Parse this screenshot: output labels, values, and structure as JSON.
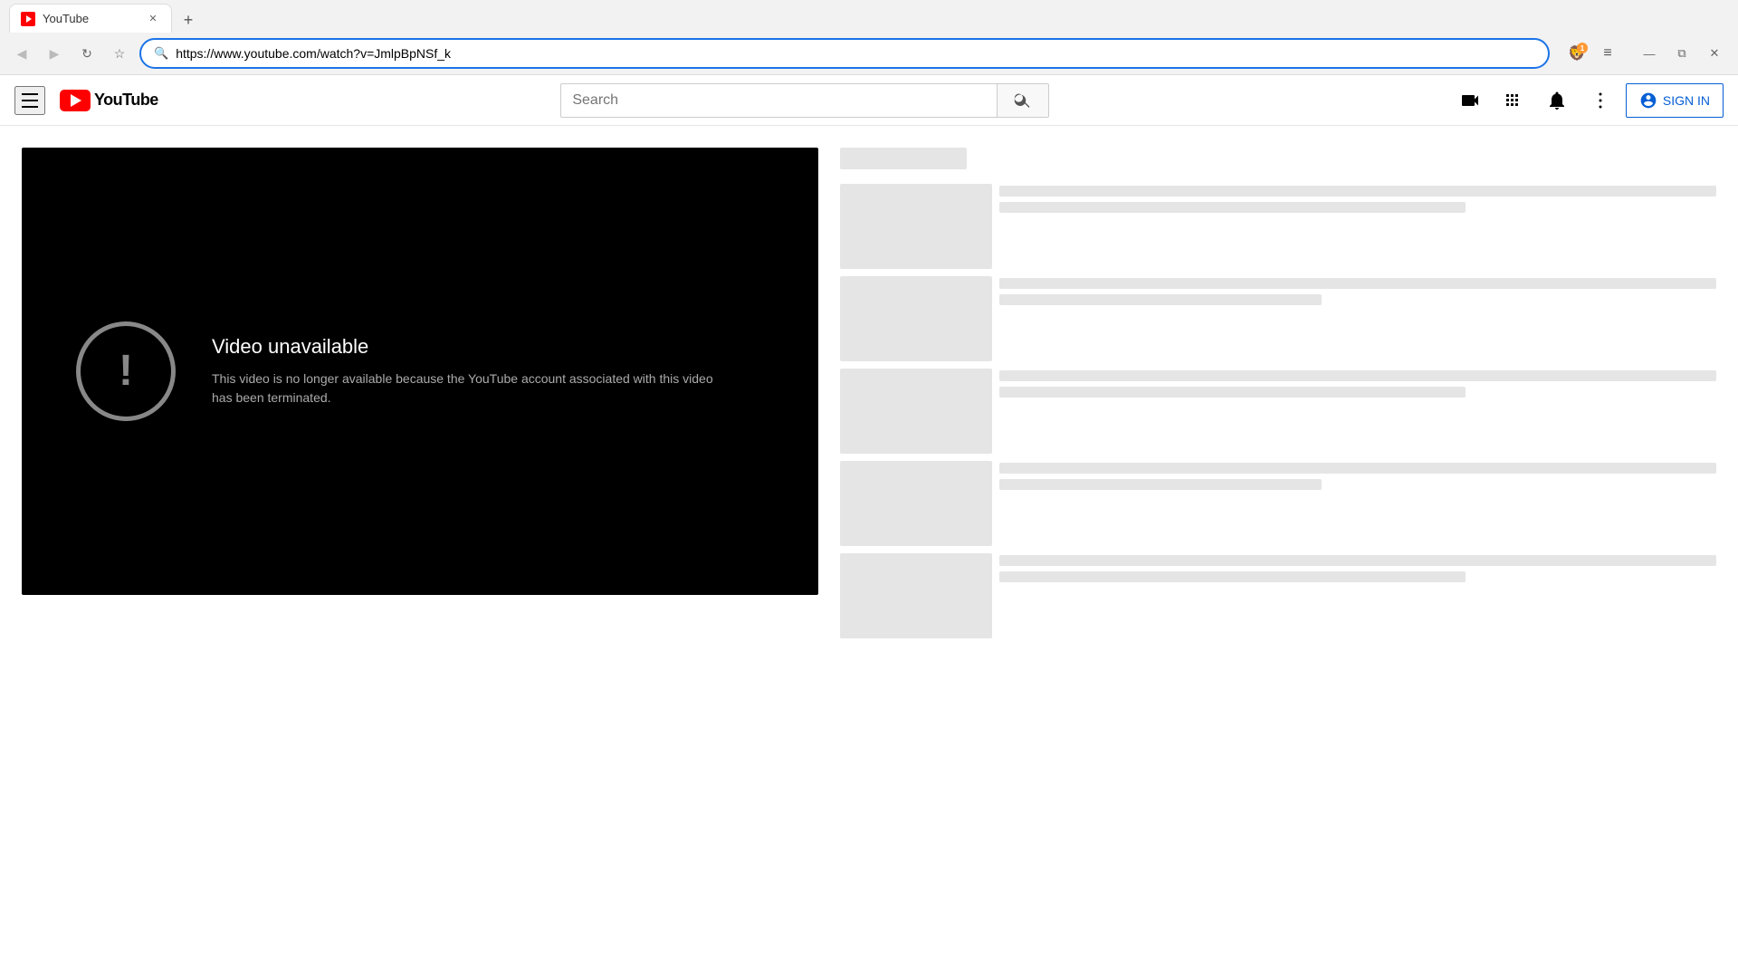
{
  "browser": {
    "address": "https://www.youtube.com/watch?v=JmlpBpNSf_k",
    "tab_title": "YouTube",
    "back_disabled": true,
    "forward_disabled": true,
    "brave_badge": "1",
    "new_tab_label": "+"
  },
  "header": {
    "logo_text": "YouTube",
    "search_placeholder": "Search",
    "signin_label": "SIGN IN",
    "hamburger_label": "Menu"
  },
  "video": {
    "error_title": "Video unavailable",
    "error_desc": "This video is no longer available because the YouTube account associated with this video has been terminated."
  },
  "sidebar": {
    "items": [
      {
        "id": 1
      },
      {
        "id": 2
      },
      {
        "id": 3
      },
      {
        "id": 4
      },
      {
        "id": 5
      }
    ]
  },
  "icons": {
    "back": "◀",
    "forward": "▶",
    "refresh": "↻",
    "bookmark": "🔖",
    "shield": "🛡",
    "menu": "≡",
    "minimize": "—",
    "maximize": "❐",
    "close": "✕",
    "search": "🔍",
    "camera": "📹",
    "apps": "⊞",
    "notifications": "🔔",
    "more": "⋮",
    "user": "👤"
  }
}
